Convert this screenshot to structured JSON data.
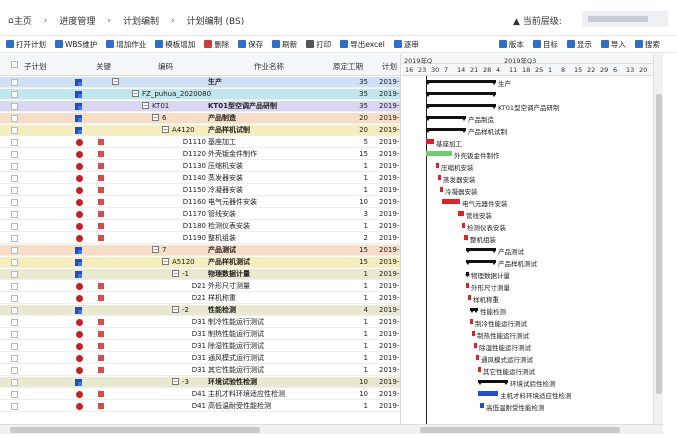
{
  "breadcrumb": [
    "主页",
    "进度管理",
    "计划编制",
    "计划编制 (BS)"
  ],
  "level_label": "当前层级:",
  "toolbar": [
    "打开计划",
    "WBS维护",
    "增加作业",
    "模板增加",
    "删除",
    "保存",
    "刷新",
    "打印",
    "导出excel",
    "逐审",
    "版本",
    "目标",
    "显示",
    "导入",
    "搜索"
  ],
  "columns": {
    "subplan": "子计划",
    "key": "关键",
    "code": "编码",
    "name": "作业名称",
    "dur": "原定工期",
    "plan": "计划"
  },
  "gantt_header": {
    "q1": "2019年Q",
    "q2": "2019年Q3",
    "days": [
      "16",
      "23",
      "30",
      "7",
      "14",
      "21",
      "28",
      "4",
      "11",
      "18",
      "25",
      "1",
      "8",
      "15",
      "22",
      "29",
      "6",
      "13",
      "20"
    ]
  },
  "rows": [
    {
      "code": "",
      "name": "生产",
      "dur": "35",
      "plan": "2019-(",
      "type": "sq",
      "cls": "blue",
      "gl": "生产"
    },
    {
      "code": "FZ_puhua_2020080",
      "name": "",
      "dur": "35",
      "plan": "2019-(",
      "type": "sq",
      "cls": "teal",
      "gl": ""
    },
    {
      "code": "KT01",
      "name": "KT01型空调产品研制",
      "dur": "35",
      "plan": "2019-(",
      "type": "sq",
      "cls": "lav",
      "gl": "KT01型空调产品研制"
    },
    {
      "code": "6",
      "name": "产品制造",
      "dur": "20",
      "plan": "2019-(",
      "type": "sq",
      "cls": "orange",
      "gl": "产品制造"
    },
    {
      "code": "A4120",
      "name": "产品样机试制",
      "dur": "20",
      "plan": "2019-(",
      "type": "sq",
      "cls": "yellow",
      "gl": "产品样机试制"
    },
    {
      "code": "D1110",
      "name": "基座加工",
      "dur": "5",
      "plan": "2019-(",
      "type": "dot",
      "gl": "基座加工"
    },
    {
      "code": "D1120",
      "name": "外壳钣金件制作",
      "dur": "15",
      "plan": "2019-(",
      "type": "dot",
      "gl": "外壳钣金件制作"
    },
    {
      "code": "D1130",
      "name": "压缩机安装",
      "dur": "1",
      "plan": "2019-(",
      "type": "dot",
      "gl": "压缩机安装"
    },
    {
      "code": "D1140",
      "name": "蒸发器安装",
      "dur": "1",
      "plan": "2019-(",
      "type": "dot",
      "gl": "蒸发器安装"
    },
    {
      "code": "D1150",
      "name": "冷凝器安装",
      "dur": "1",
      "plan": "2019-(",
      "type": "dot",
      "gl": "冷凝器安装"
    },
    {
      "code": "D1160",
      "name": "电气元器件安装",
      "dur": "10",
      "plan": "2019-(",
      "type": "dot",
      "gl": "电气元器件安装"
    },
    {
      "code": "D1170",
      "name": "管线安装",
      "dur": "3",
      "plan": "2019-(",
      "type": "dot",
      "gl": "管线安装"
    },
    {
      "code": "D1180",
      "name": "检测仪表安装",
      "dur": "1",
      "plan": "2019-(",
      "type": "dot",
      "gl": "检测仪表安装"
    },
    {
      "code": "D1190",
      "name": "整机组装",
      "dur": "2",
      "plan": "2019-(",
      "type": "dot",
      "gl": "整机组装"
    },
    {
      "code": "7",
      "name": "产品测试",
      "dur": "15",
      "plan": "2019-(",
      "type": "sq",
      "cls": "orange",
      "gl": "产品测试"
    },
    {
      "code": "A5120",
      "name": "产品样机测试",
      "dur": "15",
      "plan": "2019-(",
      "type": "sq",
      "cls": "yellow",
      "gl": "产品样机测试"
    },
    {
      "code": "-1",
      "name": "物理数据计量",
      "dur": "1",
      "plan": "2019-(",
      "type": "sq",
      "cls": "khaki",
      "gl": "物理数据计量"
    },
    {
      "code": "D21",
      "name": "外形尺寸测量",
      "dur": "1",
      "plan": "2019-(",
      "type": "dot",
      "gl": "外形尺寸测量"
    },
    {
      "code": "D21",
      "name": "样机称重",
      "dur": "1",
      "plan": "2019-(",
      "type": "dot",
      "gl": "样机称重"
    },
    {
      "code": "-2",
      "name": "性能检测",
      "dur": "4",
      "plan": "2019-(",
      "type": "sq",
      "cls": "khaki",
      "gl": "性能检测"
    },
    {
      "code": "D31",
      "name": "制冷性能运行测试",
      "dur": "1",
      "plan": "2019-(",
      "type": "dot",
      "gl": "制冷性能运行测试"
    },
    {
      "code": "D31",
      "name": "制热性能运行测试",
      "dur": "1",
      "plan": "2019-(",
      "type": "dot",
      "gl": "制热性能运行测试"
    },
    {
      "code": "D31",
      "name": "除湿性能运行测试",
      "dur": "1",
      "plan": "2019-(",
      "type": "dot",
      "gl": "除湿性能运行测试"
    },
    {
      "code": "D31",
      "name": "通风模式运行测试",
      "dur": "1",
      "plan": "2019-(",
      "type": "dot",
      "gl": "通风模式运行测试"
    },
    {
      "code": "D31",
      "name": "其它性能运行测试",
      "dur": "1",
      "plan": "2019-(",
      "type": "dot",
      "gl": "其它性能运行测试"
    },
    {
      "code": "-3",
      "name": "环境试验性检测",
      "dur": "10",
      "plan": "2019-(",
      "type": "sq",
      "cls": "khaki",
      "gl": "环境试验性检测"
    },
    {
      "code": "D41",
      "name": "主机才料环境适应性检测",
      "dur": "10",
      "plan": "2019-(",
      "type": "dot",
      "gl": "主机才料环境适应性检测"
    },
    {
      "code": "D41",
      "name": "高低温耐受性能检测",
      "dur": "1",
      "plan": "2019-(",
      "type": "dot",
      "gl": "高低温耐受性能检测"
    }
  ],
  "colors": {
    "blue": "#cfe0f6",
    "teal": "#bfe7ef",
    "lav": "#d9d6f3",
    "orange": "#f9dcc4",
    "yellow": "#f6edbd",
    "khaki": "#e9e9cf"
  }
}
